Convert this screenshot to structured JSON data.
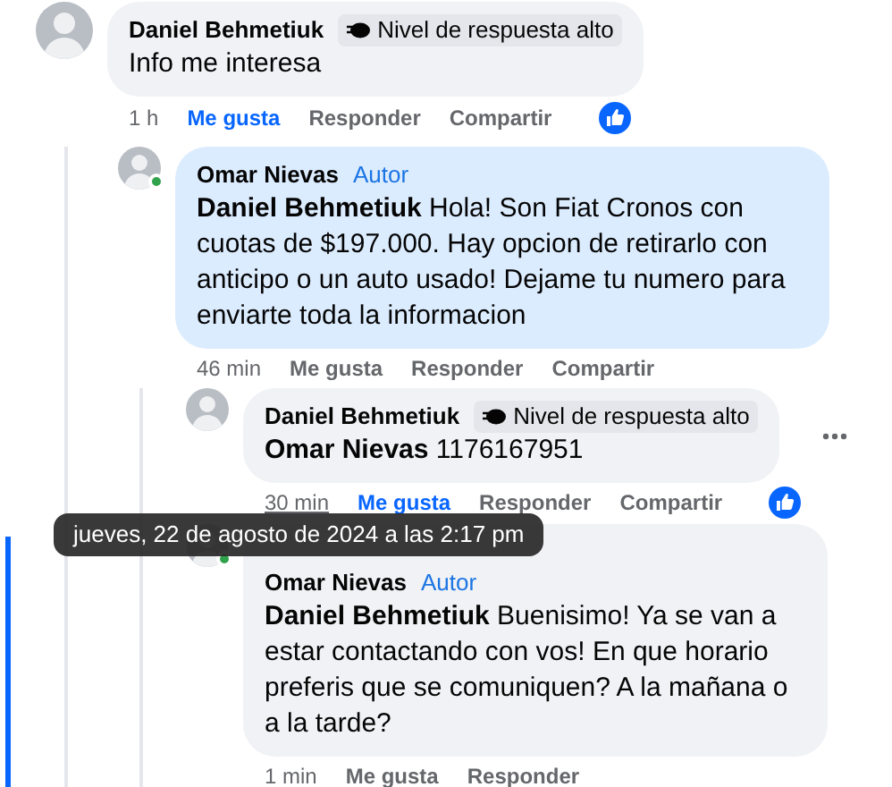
{
  "comments": [
    {
      "author": "Daniel Behmetiuk",
      "online": false,
      "badge": "Nivel de respuesta alto",
      "text": "Info me interesa",
      "highlighted": false,
      "time": "1 h",
      "time_hovered": false,
      "like": "Me gusta",
      "liked": true,
      "reply": "Responder",
      "share": "Compartir",
      "reaction": true,
      "has_menu": false,
      "children": [
        {
          "author": "Omar Nievas",
          "author_tag": "Autor",
          "online": true,
          "mention": "Daniel Behmetiuk",
          "text": "Hola! Son Fiat Cronos con cuotas de $197.000. Hay opcion de retirarlo con anticipo o un auto usado! Dejame tu numero para enviarte toda la informacion",
          "highlighted": true,
          "time": "46 min",
          "time_hovered": false,
          "like": "Me gusta",
          "liked": false,
          "reply": "Responder",
          "share": "Compartir",
          "reaction": false,
          "has_menu": false,
          "children": [
            {
              "author": "Daniel Behmetiuk",
              "online": false,
              "badge": "Nivel de respuesta alto",
              "mention": "Omar Nievas",
              "text": "1176167951",
              "highlighted": false,
              "time": "30 min",
              "time_hovered": true,
              "like": "Me gusta",
              "liked": true,
              "reply": "Responder",
              "share": "Compartir",
              "reaction": true,
              "has_menu": true
            },
            {
              "author": "Omar Nievas",
              "author_tag": "Autor",
              "online": true,
              "mention": "Daniel Behmetiuk",
              "text": "Buenisimo! Ya se van a estar contactando con vos! En que horario preferis que se comuniquen? A la mañana o a la tarde?",
              "highlighted": false,
              "time": "1 min",
              "time_hovered": false,
              "like": "Me gusta",
              "liked": false,
              "reply": "Responder",
              "reaction": false,
              "has_menu": false
            }
          ]
        }
      ]
    }
  ],
  "tooltip": {
    "text": "jueves, 22 de agosto de 2024 a las 2:17 pm"
  }
}
